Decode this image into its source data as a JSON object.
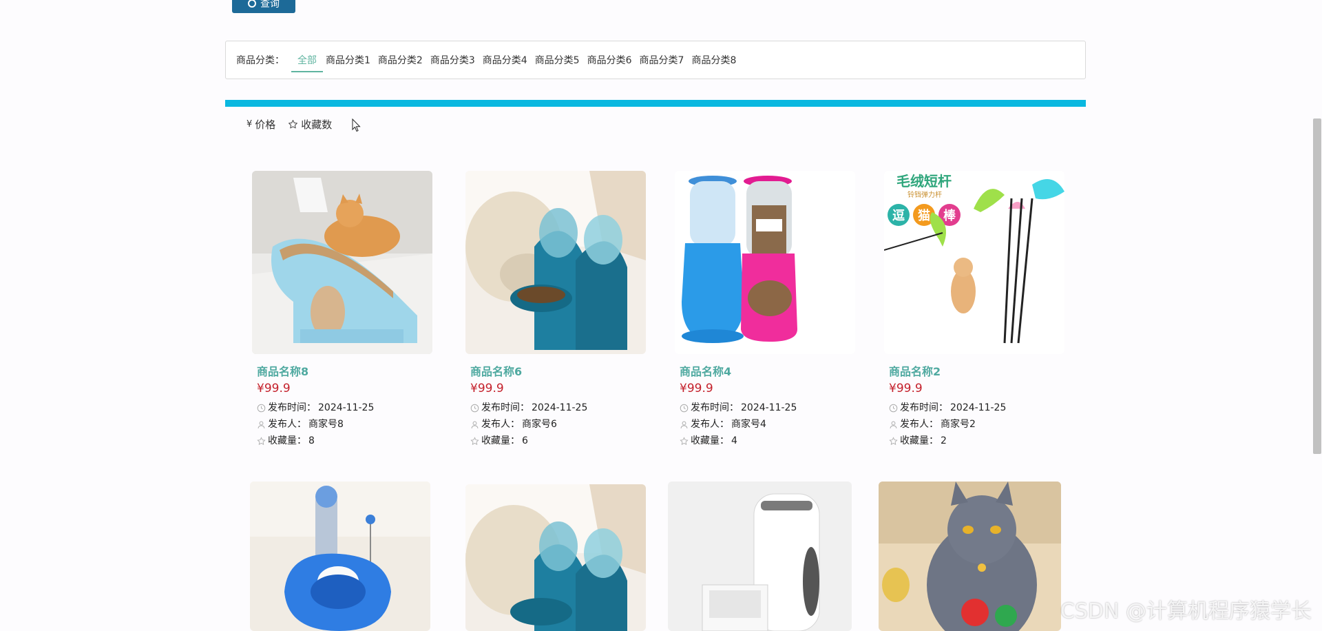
{
  "search": {
    "label": "查询"
  },
  "categories": {
    "label": "商品分类：",
    "items": [
      "全部",
      "商品分类1",
      "商品分类2",
      "商品分类3",
      "商品分类4",
      "商品分类5",
      "商品分类6",
      "商品分类7",
      "商品分类8"
    ],
    "active": "全部"
  },
  "sort": {
    "price_label": "价格",
    "price_symbol": "¥",
    "favorites_label": "收藏数"
  },
  "products": [
    {
      "name": "商品名称8",
      "price": "¥99.9",
      "time_label": "发布时间：",
      "time": "2024-11-25",
      "publisher_label": "发布人：",
      "publisher": "商家号8",
      "fav_label": "收藏量：",
      "fav": "8"
    },
    {
      "name": "商品名称6",
      "price": "¥99.9",
      "time_label": "发布时间：",
      "time": "2024-11-25",
      "publisher_label": "发布人：",
      "publisher": "商家号6",
      "fav_label": "收藏量：",
      "fav": "6"
    },
    {
      "name": "商品名称4",
      "price": "¥99.9",
      "time_label": "发布时间：",
      "time": "2024-11-25",
      "publisher_label": "发布人：",
      "publisher": "商家号4",
      "fav_label": "收藏量：",
      "fav": "4"
    },
    {
      "name": "商品名称2",
      "price": "¥99.9",
      "time_label": "发布时间：",
      "time": "2024-11-25",
      "publisher_label": "发布人：",
      "publisher": "商家号2",
      "fav_label": "收藏量：",
      "fav": "2"
    }
  ],
  "image_text": {
    "toy_title": "毛绒短杆",
    "toy_sub": "铃铛弹力杆",
    "toy_c1": "逗",
    "toy_c2": "猫",
    "toy_c3": "棒"
  },
  "watermark": "CSDN @计算机程序猿学长",
  "colors": {
    "accent": "#5fb4a0",
    "price": "#c4202b",
    "bar": "#0ab8e0",
    "button": "#1d6a98"
  }
}
